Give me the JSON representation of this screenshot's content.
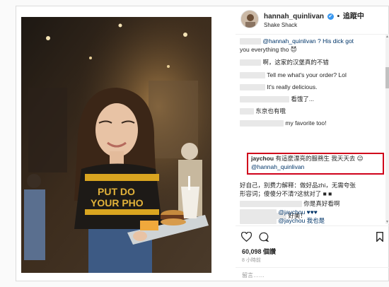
{
  "header": {
    "username": "hannah_quinlivan",
    "verified_mark": "✔",
    "separator": "•",
    "follow_status": "追蹤中",
    "location": "Shake Shack"
  },
  "photo": {
    "shirt_text_line1": "PUT DO",
    "shirt_text_line2": "YOUR PHO"
  },
  "comments": [
    {
      "text": "@hannah_quinlivan ? His dick got"
    },
    {
      "text": "you everything tho 😈"
    },
    {
      "text": "啊，这家的汉堡真的不错"
    },
    {
      "text": "Tell me what's your order? Lol"
    },
    {
      "text": "It's really delicious."
    },
    {
      "text": "看饿了..."
    },
    {
      "text": "东京也有哦"
    },
    {
      "text": "my favorite too!"
    },
    {
      "author": "jaychou",
      "text": "有這麼漂亮的服務生 我天天去 😉"
    },
    {
      "text": "@hannah_quinlivan"
    },
    {
      "text": "好自己，别费力解释：做好品zhi，无需夸张"
    },
    {
      "text": "形容词；傻傻分不清?这就对了 ■ ■"
    },
    {
      "text": "你是真好看啊"
    },
    {
      "text": "好美！"
    },
    {
      "text": "@jaychou ♥♥♥"
    },
    {
      "text": "@jaychou  我也是"
    }
  ],
  "scrollbar": {
    "up": "▲",
    "down": "▼"
  },
  "stats": {
    "likes": "60,098 個讚",
    "time": "8 小時前"
  },
  "add_comment": {
    "placeholder": "留言……"
  },
  "icons": [
    "heart-icon",
    "comment-icon",
    "bookmark-icon"
  ]
}
